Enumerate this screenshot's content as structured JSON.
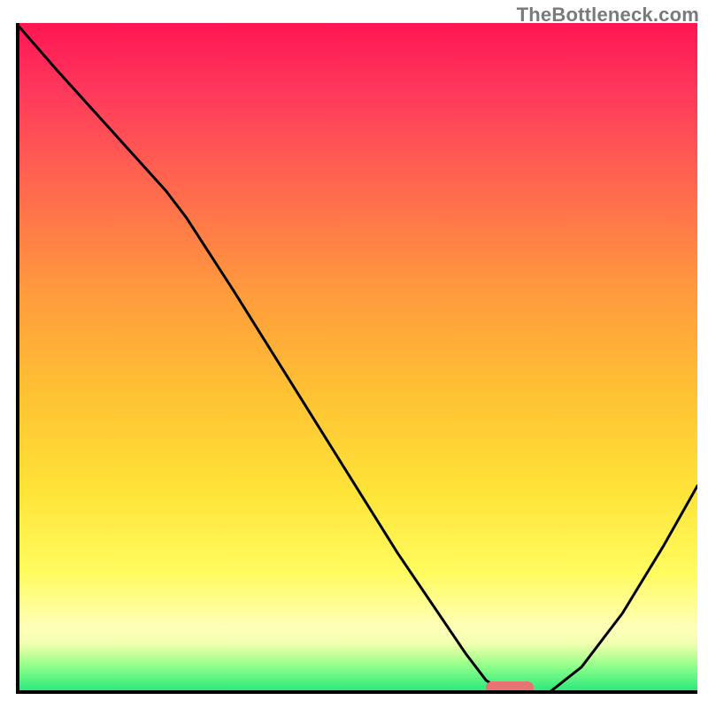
{
  "watermark": "TheBottleneck.com",
  "chart_data": {
    "type": "line",
    "title": "",
    "xlabel": "",
    "ylabel": "",
    "xlim": [
      0,
      100
    ],
    "ylim": [
      0,
      100
    ],
    "x": [
      0,
      6,
      14,
      22,
      25,
      32,
      40,
      48,
      56,
      62,
      66,
      69,
      72,
      75,
      78,
      83,
      89,
      95,
      100
    ],
    "values": [
      100,
      93,
      84,
      75,
      71,
      60,
      47,
      34,
      21,
      12,
      6,
      2,
      0,
      0,
      0,
      4,
      12,
      22,
      31
    ],
    "series": [
      {
        "name": "bottleneck-curve",
        "values_ref": "values"
      }
    ],
    "marker": {
      "x_start": 69,
      "x_end": 76,
      "y": 0,
      "color": "#e97272"
    },
    "gradient_stops": [
      {
        "pos": 0.0,
        "color": "#ff1552"
      },
      {
        "pos": 0.4,
        "color": "#ff9a3d"
      },
      {
        "pos": 0.82,
        "color": "#fffc60"
      },
      {
        "pos": 1.0,
        "color": "#1ee57a"
      }
    ]
  }
}
